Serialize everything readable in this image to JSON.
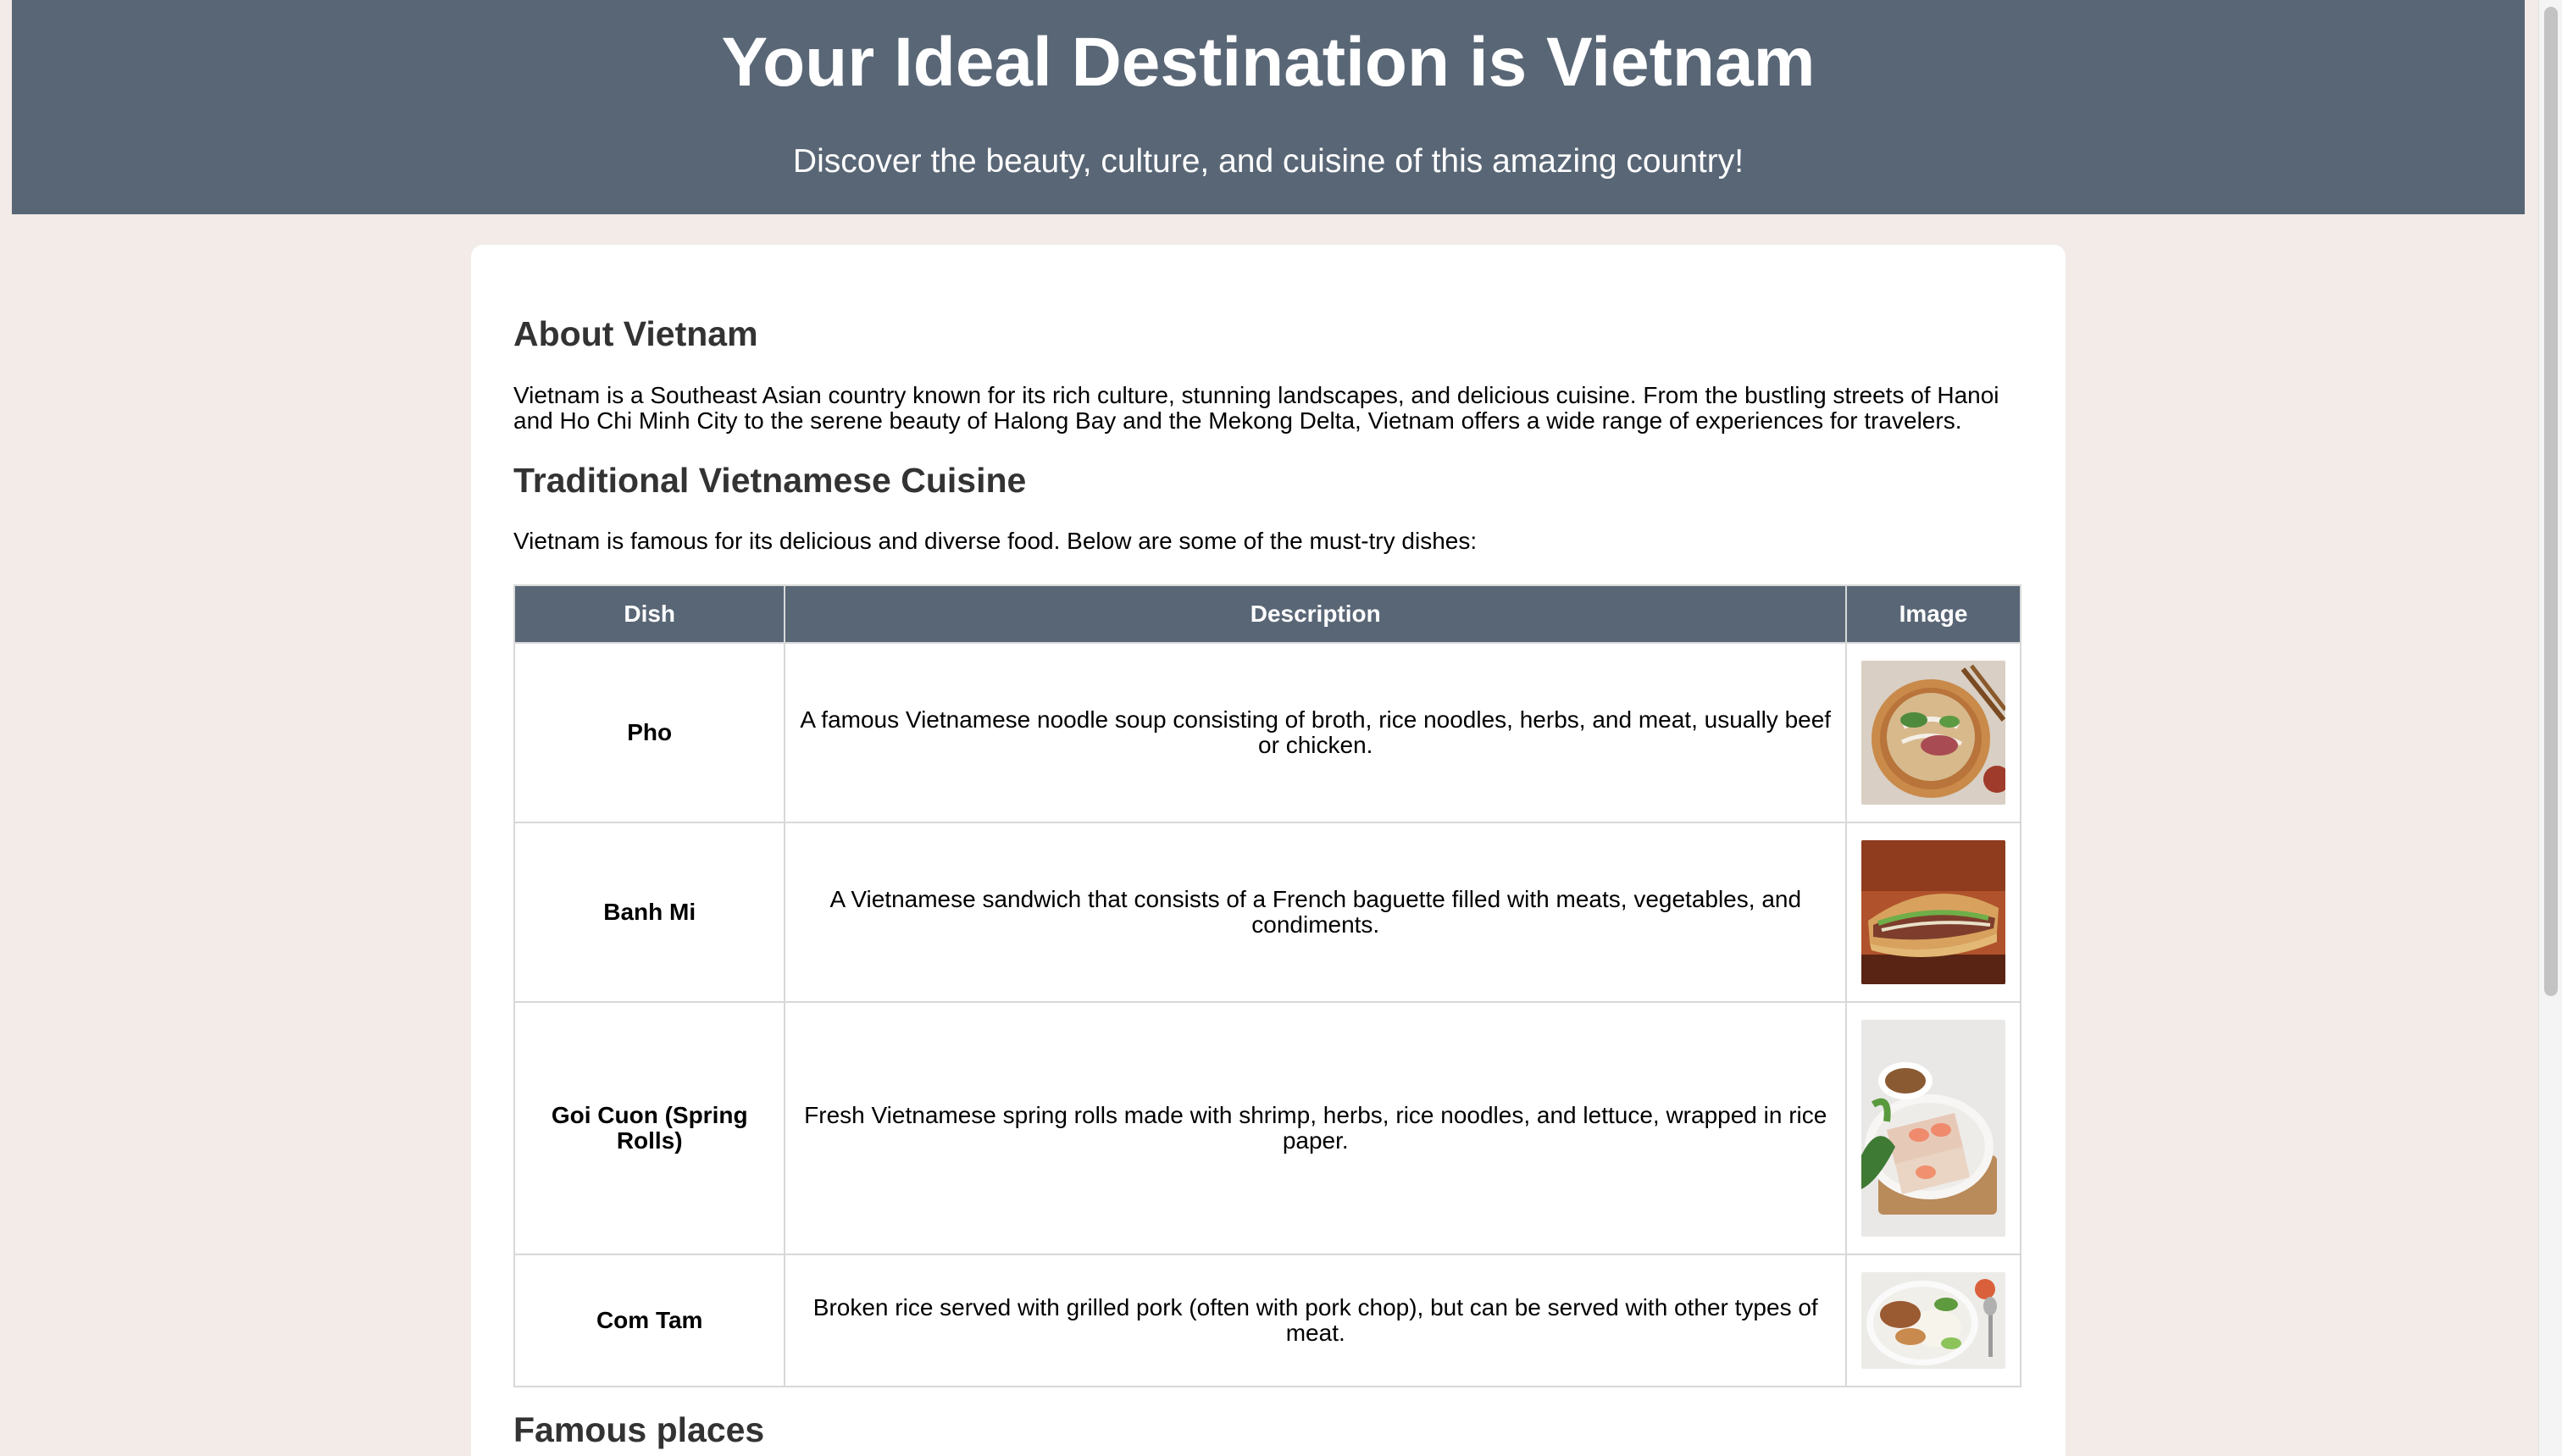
{
  "header": {
    "title": "Your Ideal Destination is Vietnam",
    "tagline": "Discover the beauty, culture, and cuisine of this amazing country!"
  },
  "about": {
    "heading": "About Vietnam",
    "text": "Vietnam is a Southeast Asian country known for its rich culture, stunning landscapes, and delicious cuisine. From the bustling streets of Hanoi and Ho Chi Minh City to the serene beauty of Halong Bay and the Mekong Delta, Vietnam offers a wide range of experiences for travelers."
  },
  "cuisine": {
    "heading": "Traditional Vietnamese Cuisine",
    "intro": "Vietnam is famous for its delicious and diverse food. Below are some of the must-try dishes:",
    "columns": [
      "Dish",
      "Description",
      "Image"
    ],
    "dishes": [
      {
        "name": "Pho",
        "description": "A famous Vietnamese noodle soup consisting of broth, rice noodles, herbs, and meat, usually beef or chicken.",
        "image_icon": "pho-bowl-image"
      },
      {
        "name": "Banh Mi",
        "description": "A Vietnamese sandwich that consists of a French baguette filled with meats, vegetables, and condiments.",
        "image_icon": "banh-mi-sandwich-image"
      },
      {
        "name": "Goi Cuon (Spring Rolls)",
        "description": "Fresh Vietnamese spring rolls made with shrimp, herbs, rice noodles, and lettuce, wrapped in rice paper.",
        "image_icon": "spring-rolls-image"
      },
      {
        "name": "Com Tam",
        "description": "Broken rice served with grilled pork (often with pork chop), but can be served with other types of meat.",
        "image_icon": "com-tam-plate-image"
      }
    ]
  },
  "famous_places": {
    "heading": "Famous places"
  },
  "colors": {
    "header_bg": "#596676",
    "page_bg": "#f2ebe8",
    "heading_text": "#333333"
  }
}
